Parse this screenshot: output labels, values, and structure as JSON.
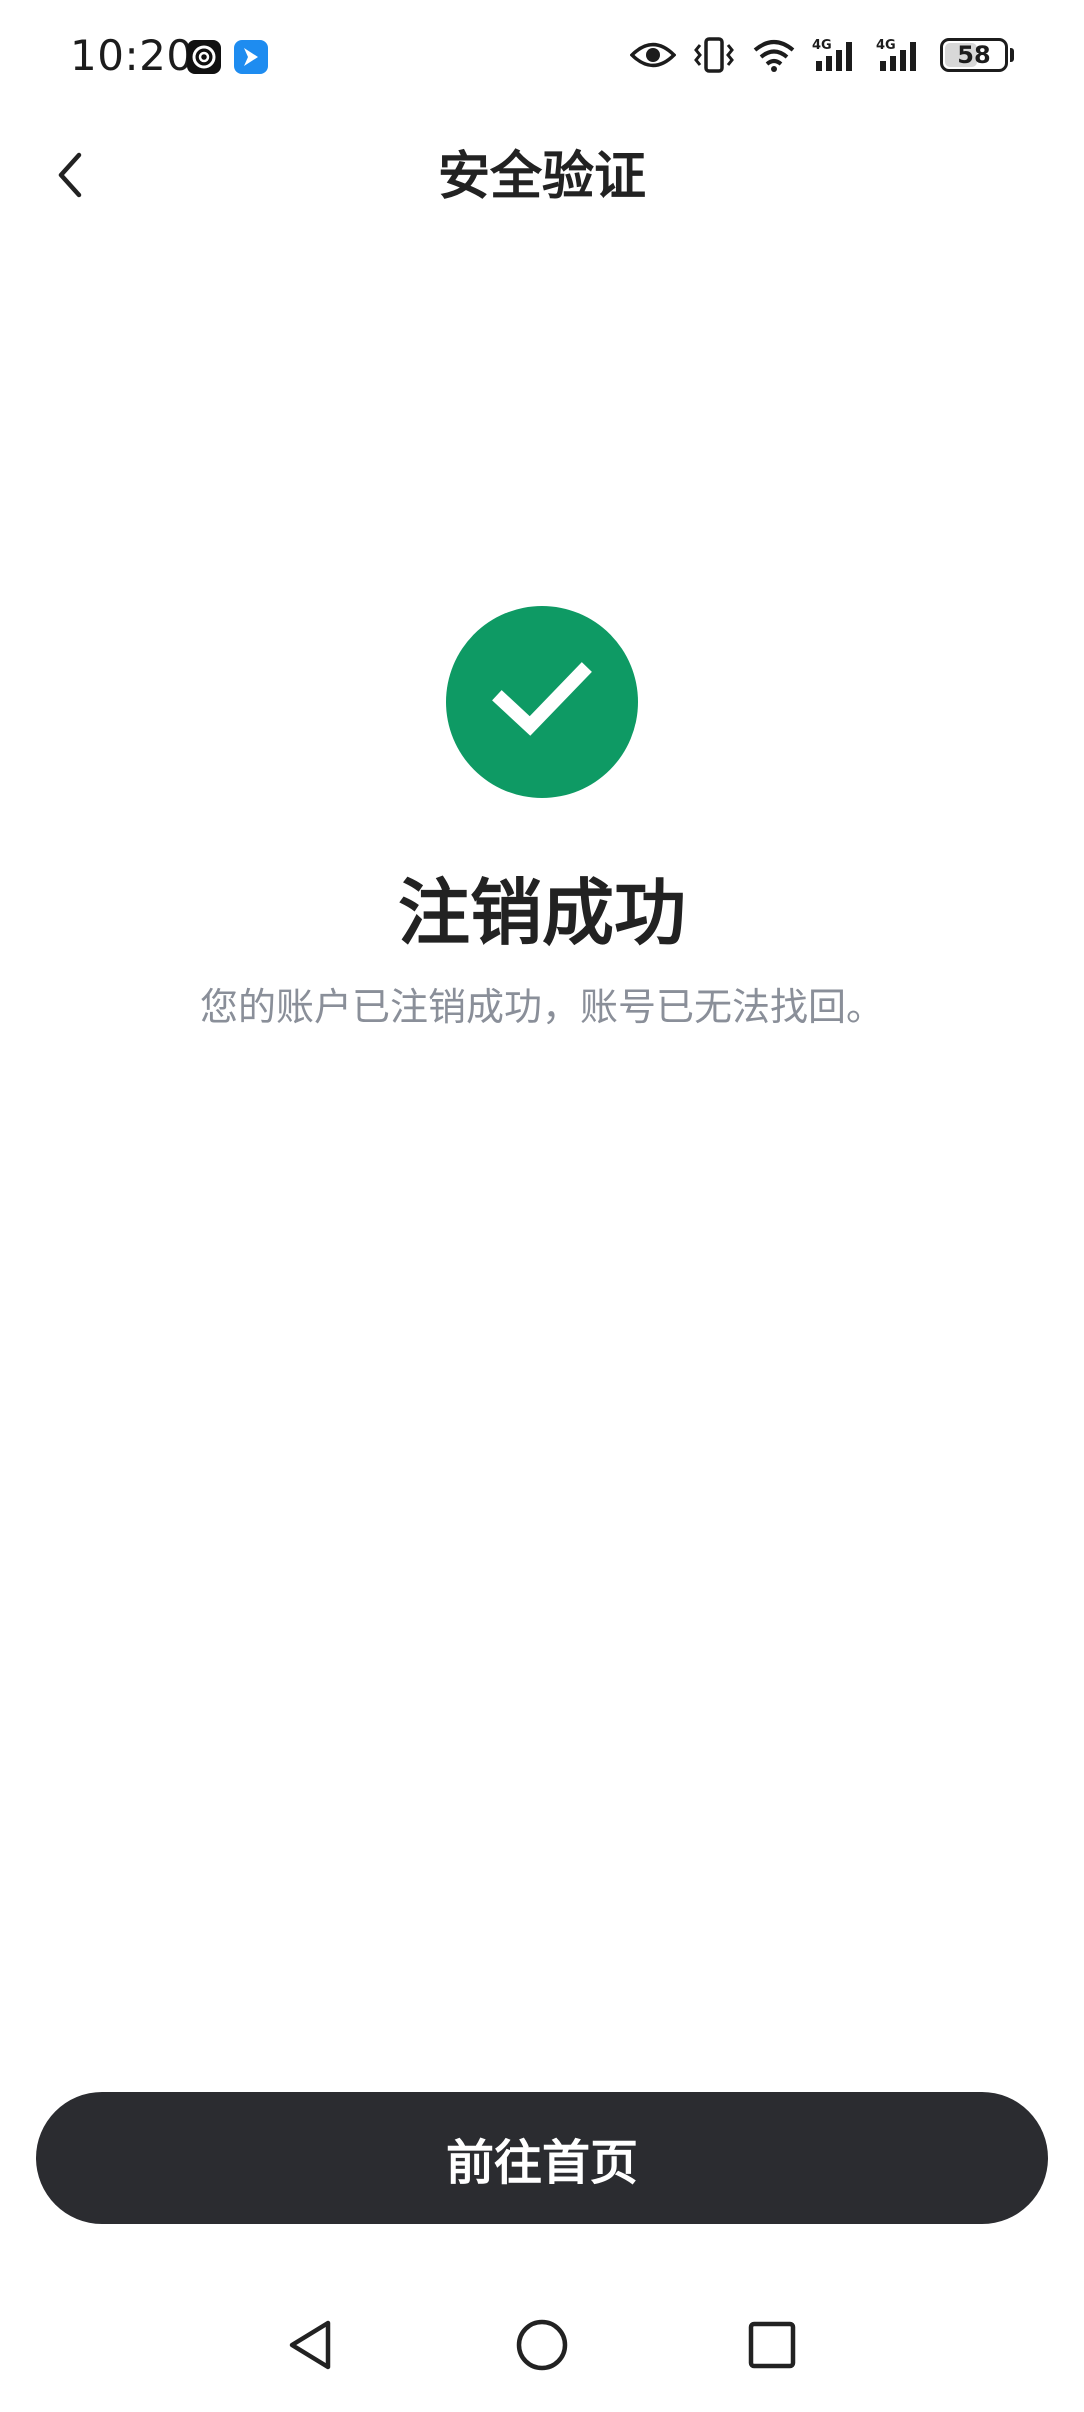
{
  "status_bar": {
    "time": "10:20",
    "battery_level": "58",
    "battery_fraction": 0.58,
    "network_labels": [
      "4G",
      "4G"
    ],
    "icons": [
      "app-notification-icon",
      "app-notification-icon",
      "eye-icon",
      "vibrate-icon",
      "wifi-icon",
      "signal-4g-icon",
      "signal-4g-icon",
      "battery-icon"
    ]
  },
  "header": {
    "title": "安全验证",
    "back_icon": "chevron-left-icon"
  },
  "result": {
    "icon": "checkmark-icon",
    "icon_color": "#0e9a64",
    "title": "注销成功",
    "description": "您的账户已注销成功，账号已无法找回。"
  },
  "actions": {
    "primary_label": "前往首页",
    "primary_color": "#2b2c30"
  },
  "nav_bar": {
    "icons": [
      "nav-back-icon",
      "nav-home-icon",
      "nav-recents-icon"
    ]
  }
}
